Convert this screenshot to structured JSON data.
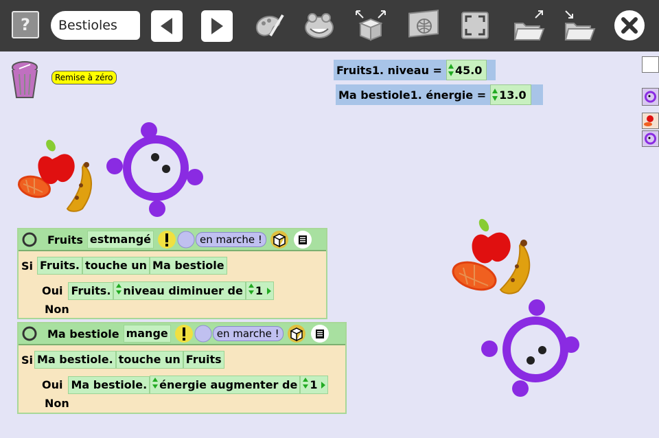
{
  "toolbar": {
    "help_label": "?",
    "project_name": "Bestioles",
    "buttons": [
      "back-icon",
      "forward-icon",
      "paint-icon",
      "frog-icon",
      "box-icon",
      "web-icon",
      "fullscreen-icon",
      "open-folder-icon",
      "save-folder-icon",
      "close-icon"
    ]
  },
  "workspace": {
    "reset_label": "Remise à zéro",
    "monitors": [
      {
        "label": "Fruits1. niveau =",
        "value": "45.0"
      },
      {
        "label": "Ma bestiole1. énergie =",
        "value": "13.0"
      }
    ]
  },
  "blocks": [
    {
      "object": "Fruits",
      "event": "estmangé",
      "running": "en marche !",
      "si": "Si",
      "subject": "Fruits.",
      "predicate": "touche un",
      "target": "Ma bestiole",
      "oui": "Oui",
      "action_subject": "Fruits.",
      "action": "niveau diminuer de",
      "amount": "1",
      "non": "Non"
    },
    {
      "object": "Ma bestiole",
      "event": "mange",
      "running": "en marche !",
      "si": "Si",
      "subject": "Ma bestiole.",
      "predicate": "touche un",
      "target": "Fruits",
      "oui": "Oui",
      "action_subject": "Ma bestiole.",
      "action": "énergie augmenter de",
      "amount": "1",
      "non": "Non"
    }
  ],
  "colors": {
    "toolbar": "#3c3c3c",
    "background": "#e4e4f6",
    "creature": "#8a2be2",
    "reset": "#ffff00"
  }
}
